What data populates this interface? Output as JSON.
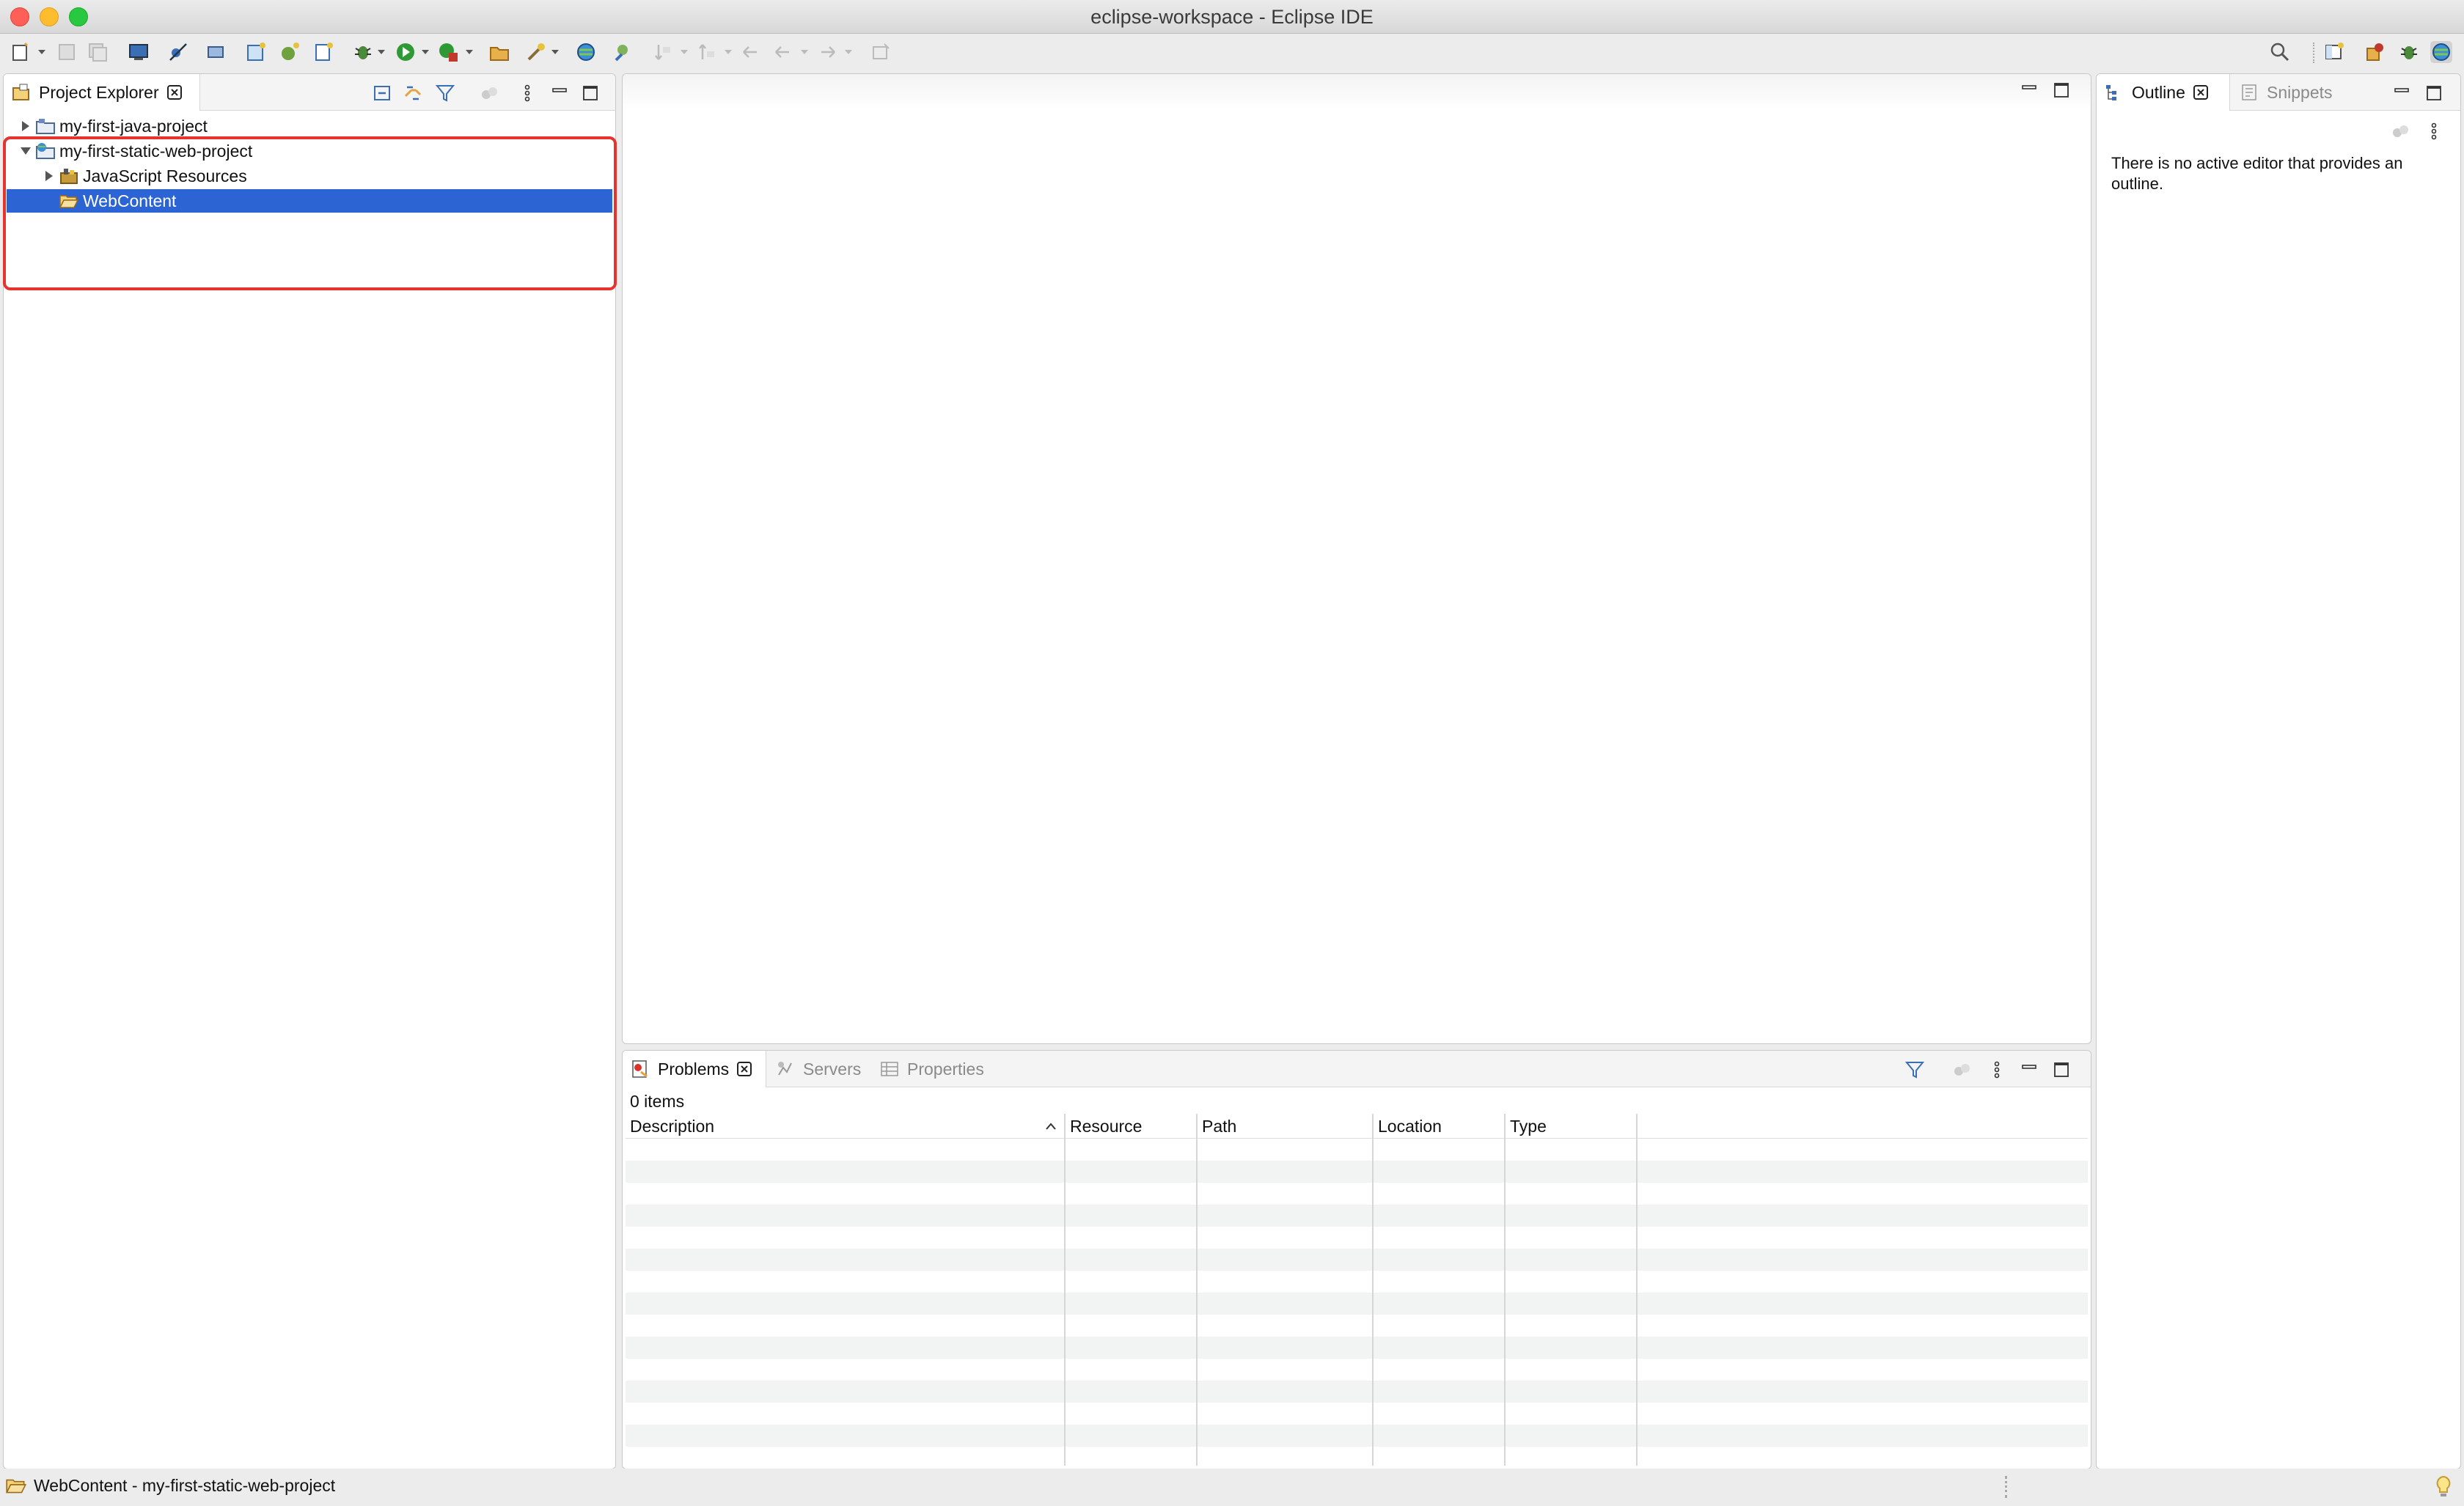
{
  "window": {
    "title": "eclipse-workspace - Eclipse IDE"
  },
  "colors": {
    "selection": "#2c65d3",
    "highlight_box": "#e53330",
    "close": "#fe5f57",
    "minimize": "#febc2e",
    "zoom": "#28c840"
  },
  "toolbar": {
    "icons": [
      "new-icon",
      "save-icon",
      "save-all-icon",
      "terminal-icon",
      "skip-breakpoints-icon",
      "new-server-icon",
      "new-project-icon",
      "new-class-icon",
      "new-file-icon",
      "debug-icon",
      "run-icon",
      "external-tools-icon",
      "open-type-icon",
      "open-task-icon",
      "web-browser-icon",
      "search-icon",
      "next-annotation-icon",
      "prev-annotation-icon",
      "back-icon",
      "forward-icon",
      "pin-editor-icon"
    ],
    "right_icons": [
      "search-icon",
      "open-perspective-icon",
      "java-ee-perspective-icon",
      "debug-perspective-icon",
      "web-perspective-icon"
    ]
  },
  "project_explorer": {
    "tab_label": "Project Explorer",
    "tree": [
      {
        "label": "my-first-java-project",
        "level": 0,
        "expanded": false,
        "selected": false,
        "icon": "java-project-icon"
      },
      {
        "label": "my-first-static-web-project",
        "level": 0,
        "expanded": true,
        "selected": false,
        "icon": "web-project-icon"
      },
      {
        "label": "JavaScript Resources",
        "level": 1,
        "expanded": false,
        "selected": false,
        "icon": "js-resources-icon"
      },
      {
        "label": "WebContent",
        "level": 1,
        "expanded": null,
        "selected": true,
        "icon": "folder-open-icon"
      }
    ]
  },
  "outline": {
    "tab_label": "Outline",
    "snippets_label": "Snippets",
    "message": "There is no active editor that provides an outline."
  },
  "problems": {
    "tabs": [
      "Problems",
      "Servers",
      "Properties"
    ],
    "count_label": "0 items",
    "columns": [
      "Description",
      "Resource",
      "Path",
      "Location",
      "Type"
    ]
  },
  "status": {
    "text": "WebContent - my-first-static-web-project"
  }
}
